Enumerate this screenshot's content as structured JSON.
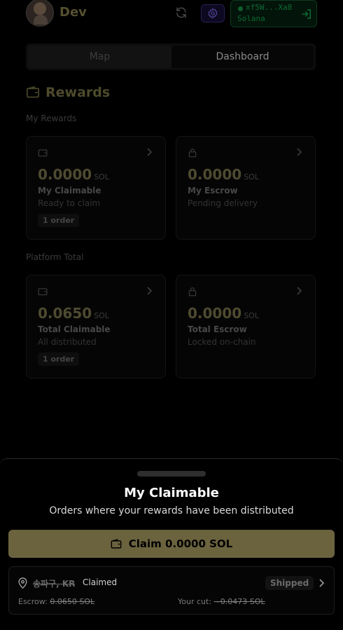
{
  "header": {
    "username": "Dev",
    "wallet_address": "xf5W...Xa8",
    "wallet_network": "Solana"
  },
  "tabs": [
    {
      "label": "Map",
      "active": false
    },
    {
      "label": "Dashboard",
      "active": true
    }
  ],
  "rewards": {
    "title": "Rewards",
    "my_section_label": "My Rewards",
    "platform_section_label": "Platform Total",
    "my_cards": [
      {
        "amount": "0.0000",
        "unit": "SOL",
        "name": "My Claimable",
        "subtitle": "Ready to claim",
        "badge": "1 order",
        "icon": "wallet-icon"
      },
      {
        "amount": "0.0000",
        "unit": "SOL",
        "name": "My Escrow",
        "subtitle": "Pending delivery",
        "icon": "lock-icon"
      }
    ],
    "platform_cards": [
      {
        "amount": "0.0650",
        "unit": "SOL",
        "name": "Total Claimable",
        "subtitle": "All distributed",
        "badge": "1 order",
        "icon": "wallet-icon"
      },
      {
        "amount": "0.0000",
        "unit": "SOL",
        "name": "Total Escrow",
        "subtitle": "Locked on-chain",
        "icon": "lock-icon"
      }
    ]
  },
  "sheet": {
    "title": "My Claimable",
    "subtitle": "Orders where your rewards have been distributed",
    "claim_label": "Claim 0.0000 SOL",
    "order": {
      "location": "송파구, KR",
      "status": "Claimed",
      "shipping_badge": "Shipped",
      "escrow_label": "Escrow:",
      "escrow_value": "0.0650 SOL",
      "cut_label": "Your cut:",
      "cut_value": "~0.0473 SOL"
    }
  },
  "colors": {
    "accent_gold": "#6b633e",
    "wallet_green": "#0e6b33",
    "settings_purple": "#2a1f55"
  }
}
